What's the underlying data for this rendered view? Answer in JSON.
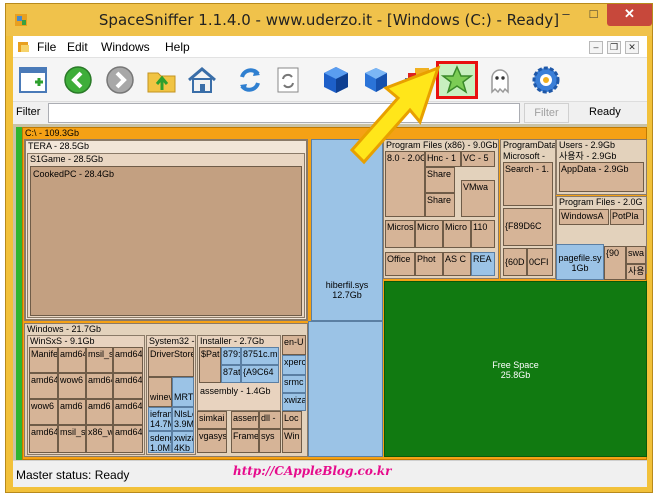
{
  "window": {
    "title": "SpaceSniffer 1.1.4.0 - www.uderzo.it - [Windows (C:) - Ready]",
    "min_glyph": "–",
    "max_glyph": "□",
    "close_glyph": "✕"
  },
  "menu": {
    "items": [
      "File",
      "Edit",
      "Windows",
      "Help"
    ],
    "mdi_min": "–",
    "mdi_restore": "❐",
    "mdi_close": "✕"
  },
  "toolbar": {
    "buttons": [
      "new-window-icon",
      "back-icon",
      "forward-icon",
      "folder-up-icon",
      "home-icon",
      "refresh-icon",
      "rescan-icon",
      "blue-cube-icon",
      "blue-cube-alt-icon",
      "colored-blocks-icon",
      "star-icon",
      "ghost-icon",
      "gear-icon"
    ],
    "highlighted": "star-icon"
  },
  "filter": {
    "label": "Filter",
    "value": "",
    "button_label": "Filter",
    "status": "Ready"
  },
  "treemap": {
    "root": "C:\\ - 109.3Gb",
    "tera": "TERA - 28.5Gb",
    "s1game": "S1Game - 28.5Gb",
    "cookedpc": "CookedPC - 28.4Gb",
    "hiberfil": "hiberfil.sys",
    "hiberfil_size": "12.7Gb",
    "windows": "Windows - 21.7Gb",
    "winsxs": "WinSxS - 9.1Gb",
    "winsxs_cells": [
      "Manife",
      "amd64",
      "msil_s",
      "amd64",
      "amd64",
      "wow6",
      "amd64",
      "amd64",
      "wow6",
      "amd6",
      "amd6",
      "amd64",
      "amd64",
      "msil_s",
      "x86_w",
      "amd64"
    ],
    "system32": "System32 -",
    "system32_cells": [
      "DriverStore",
      "winev",
      "MRT",
      "iefram 14.7M",
      "NlsLe 3.9MI",
      "sdeng 1.0MI",
      "xwiza 4Kb"
    ],
    "installer": "Installer - 2.7Gb",
    "installer_cells": [
      "$Pat",
      "879:",
      "8751c.m",
      "87at",
      "{A9C64"
    ],
    "assembly": "assembly - 1.4Gb",
    "misc_cells": [
      "simkai",
      "assem",
      "dll -",
      "Loc",
      "vgasys",
      "Frame",
      "sys",
      "Win"
    ],
    "en_col": [
      "en-U",
      "xperc",
      "srmc",
      "xwiza"
    ],
    "program_files_x86": "Program Files (x86) - 9.0Gb",
    "pfx86_cells": [
      "8.0 - 2.0G",
      "Hnc - 1",
      "VC - 5",
      "Share",
      "Share",
      "VMwa",
      "Micros",
      "Micro",
      "Micro",
      "110",
      "Office",
      "Phot",
      "AS C",
      "REA"
    ],
    "programdata": "ProgramData",
    "pd_cells": [
      "Microsoft -",
      "Search - 1.",
      "{F89D6C",
      "{60D",
      "0CFI"
    ],
    "users": "Users - 2.9Gb",
    "users_cells": [
      "사용자 - 2.9Gb",
      "AppData - 2.9Gb"
    ],
    "program_files": "Program Files - 2.0G",
    "pf_cells": [
      "WindowsA",
      "PotPla"
    ],
    "pagefile": "pagefile.sy",
    "pagefile_size": "1Gb",
    "small_cells": [
      "{90",
      "swa",
      "사용"
    ],
    "free_space": "Free Space",
    "free_space_size": "25.8Gb"
  },
  "statusbar": {
    "text": "Master status: Ready",
    "watermark": "http://CAppleBlog.co.kr"
  }
}
